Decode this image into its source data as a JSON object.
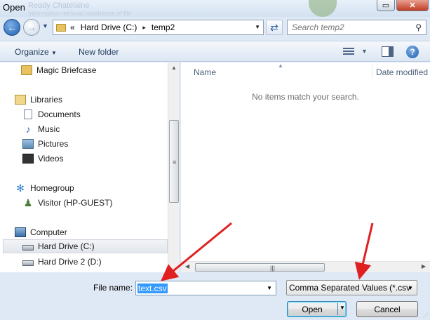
{
  "window": {
    "title": "Open",
    "background_title_fragment": "Ready Chatelaine",
    "background_subtitle_fragment": "Information retrieval databases of file",
    "close_glyph": "✕",
    "restore_glyph": "▭"
  },
  "address_bar": {
    "overflow": "«",
    "segments": [
      "Hard Drive (C:)",
      "temp2"
    ],
    "separator": "▸",
    "dropdown": "▼"
  },
  "search": {
    "placeholder": "Search temp2",
    "icon": "search-icon"
  },
  "toolbar": {
    "organize_label": "Organize",
    "organize_arrow": "▼",
    "new_folder_label": "New folder",
    "views_arrow": "▼",
    "help_glyph": "?"
  },
  "navigation": {
    "items": [
      {
        "label": "Magic Briefcase",
        "icon": "folder-icon"
      },
      {
        "label": "Libraries",
        "icon": "libraries-icon"
      },
      {
        "label": "Documents",
        "icon": "documents-icon"
      },
      {
        "label": "Music",
        "icon": "music-icon"
      },
      {
        "label": "Pictures",
        "icon": "pictures-icon"
      },
      {
        "label": "Videos",
        "icon": "videos-icon"
      },
      {
        "label": "Homegroup",
        "icon": "homegroup-icon"
      },
      {
        "label": "Visitor (HP-GUEST)",
        "icon": "user-icon"
      },
      {
        "label": "Computer",
        "icon": "computer-icon"
      },
      {
        "label": "Hard Drive (C:)",
        "icon": "drive-icon",
        "selected": true
      },
      {
        "label": "Hard Drive 2 (D:)",
        "icon": "drive-icon"
      }
    ]
  },
  "file_list": {
    "columns": [
      "Name",
      "Date modified"
    ],
    "empty_message": "No items match your search."
  },
  "bottom": {
    "file_name_label": "File name:",
    "file_name_value": "text.csv",
    "file_type_value": "Comma Separated Values (*.csv",
    "open_label": "Open",
    "cancel_label": "Cancel"
  },
  "colors": {
    "annotation_arrow": "#e02020",
    "selection": "#3399ff",
    "chrome_background": "#dfe9f5"
  }
}
